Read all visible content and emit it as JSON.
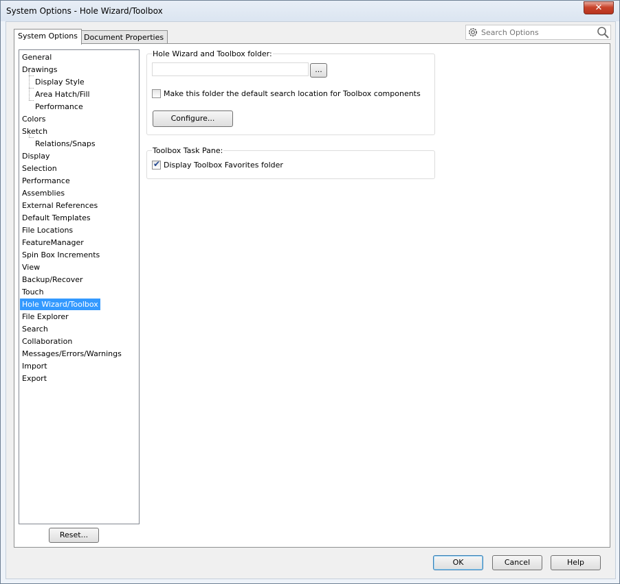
{
  "window": {
    "title": "System Options - Hole Wizard/Toolbox",
    "close_symbol": "✕"
  },
  "tabs": [
    {
      "label": "System Options",
      "active": true
    },
    {
      "label": "Document Properties",
      "active": false
    }
  ],
  "search": {
    "placeholder": "Search Options",
    "gear_icon": "gear-icon",
    "search_icon": "search-icon"
  },
  "tree": {
    "items": [
      {
        "label": "General"
      },
      {
        "label": "Drawings"
      },
      {
        "label": "Display Style"
      },
      {
        "label": "Area Hatch/Fill"
      },
      {
        "label": "Performance"
      },
      {
        "label": "Colors"
      },
      {
        "label": "Sketch"
      },
      {
        "label": "Relations/Snaps"
      },
      {
        "label": "Display"
      },
      {
        "label": "Selection"
      },
      {
        "label": "Performance"
      },
      {
        "label": "Assemblies"
      },
      {
        "label": "External References"
      },
      {
        "label": "Default Templates"
      },
      {
        "label": "File Locations"
      },
      {
        "label": "FeatureManager"
      },
      {
        "label": "Spin Box Increments"
      },
      {
        "label": "View"
      },
      {
        "label": "Backup/Recover"
      },
      {
        "label": "Touch"
      },
      {
        "label": "Hole Wizard/Toolbox"
      },
      {
        "label": "File Explorer"
      },
      {
        "label": "Search"
      },
      {
        "label": "Collaboration"
      },
      {
        "label": "Messages/Errors/Warnings"
      },
      {
        "label": "Import"
      },
      {
        "label": "Export"
      }
    ],
    "selected": "Hole Wizard/Toolbox"
  },
  "reset_label": "Reset...",
  "folder_group": {
    "title": "Hole Wizard and Toolbox folder:",
    "path_value": "",
    "browse_label": "...",
    "default_search_label": "Make this folder the default search location for Toolbox components",
    "default_search_checked": false,
    "configure_label": "Configure..."
  },
  "task_pane_group": {
    "title": "Toolbox Task Pane:",
    "favorites_label": "Display Toolbox Favorites folder",
    "favorites_checked": true,
    "check_mark": "✔"
  },
  "footer": {
    "ok_label": "OK",
    "cancel_label": "Cancel",
    "help_label": "Help"
  }
}
